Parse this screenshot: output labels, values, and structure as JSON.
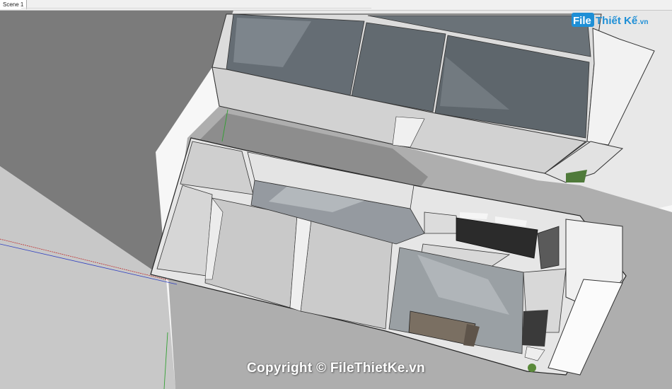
{
  "app": {
    "scene_tabs": [
      {
        "label": "Scene 1",
        "active": true
      }
    ]
  },
  "watermark": {
    "logo_text": "FileThiếtKế.vn",
    "logo_part1": "File",
    "logo_part2": "Thiết Kế",
    "logo_part3": ".vn",
    "copyright": "Copyright © FileThietKe.vn"
  },
  "colors": {
    "sky": "#fafafa",
    "ground_dark": "#7c7c7c",
    "ground_light": "#cccccc",
    "road": "#a8a8a8",
    "wall": "#d9d9d9",
    "wall_top": "#f0f0f0",
    "glass": "#5f6870",
    "floor_tile": "#9ba0a4",
    "logo_blue": "#1e8fd6",
    "axis_red": "#c03030",
    "axis_blue": "#3040c0",
    "axis_green": "#30a030"
  }
}
